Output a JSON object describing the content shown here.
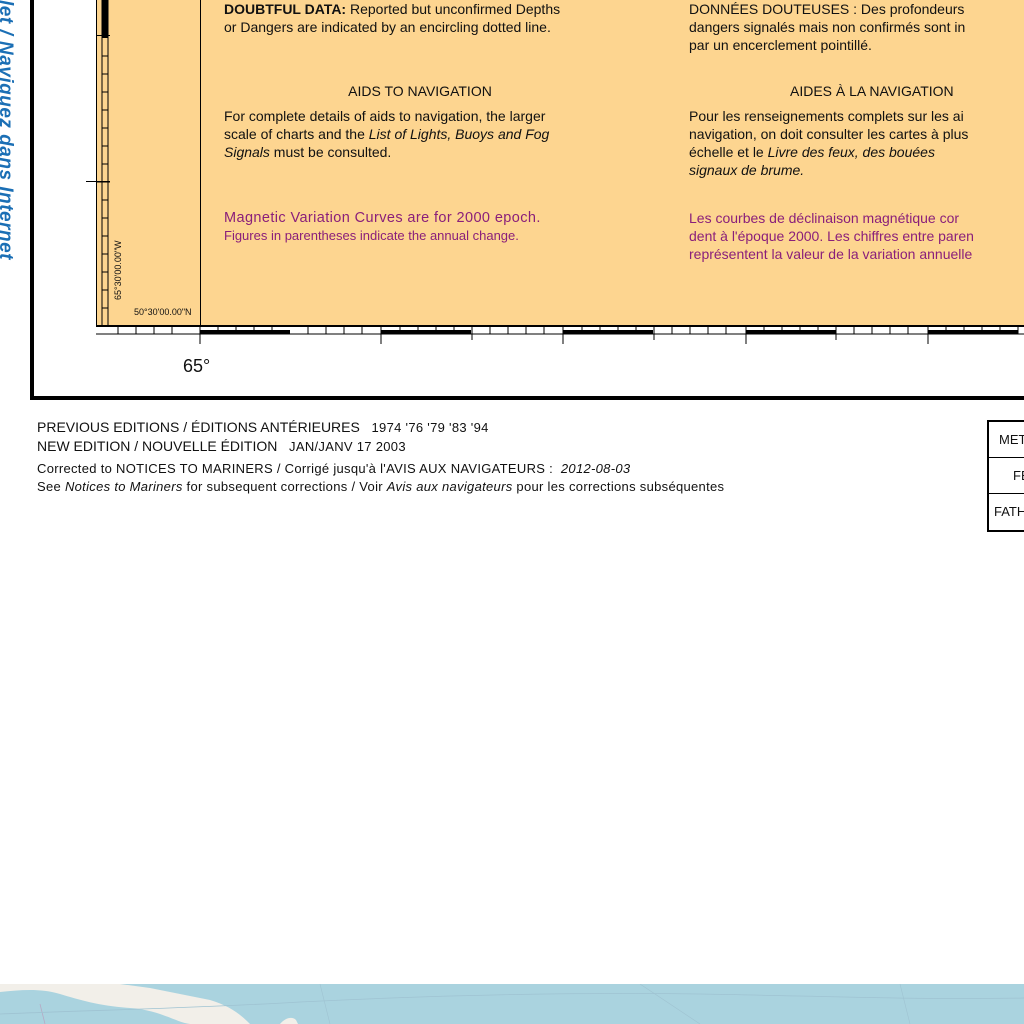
{
  "side_link": {
    "text": "let / Naviguez dans Internet",
    "color": "#1b6fb5"
  },
  "chart": {
    "panel_color": "#fdd590",
    "doubtful": {
      "en_bold": "DOUBTFUL DATA:",
      "en_rest_1": " Reported but unconfirmed Depths",
      "en_line_2": "or Dangers are indicated by an encircling dotted line.",
      "fr_line_1": "DONNÉES DOUTEUSES : Des profondeurs",
      "fr_line_2": "dangers signalés mais non confirmés sont in",
      "fr_line_3": "par un encerclement pointillé."
    },
    "aids": {
      "en_heading": "AIDS TO NAVIGATION",
      "fr_heading": "AIDES À LA NAVIGATION",
      "en_line_1": "For complete details of aids to navigation, the larger",
      "en_line_2a": "scale of charts and the ",
      "en_line_2b": "List of Lights, Buoys and Fog",
      "en_line_3a": "Signals",
      "en_line_3b": " must be consulted.",
      "fr_line_1": "Pour les renseignements complets sur les ai",
      "fr_line_2": "navigation, on doit consulter les cartes à plus",
      "fr_line_3a": "échelle et le ",
      "fr_line_3b": "Livre des feux, des bouées",
      "fr_line_4": "signaux de brume."
    },
    "magnetic": {
      "color": "#8a1f7a",
      "en_line_1": "Magnetic Variation Curves are for 2000 epoch.",
      "en_line_2": "Figures in parentheses indicate the annual change.",
      "fr_line_1": "Les courbes de déclinaison magnétique cor",
      "fr_line_2": "dent à l'époque 2000. Les chiffres entre paren",
      "fr_line_3": "représentent la valeur de la variation annuelle"
    },
    "coord_lat": "50°30'00.00\"N",
    "coord_lon": "65°30'00.00\"W",
    "degree_label": "65°"
  },
  "editions": {
    "previous_label": "PREVIOUS EDITIONS / ÉDITIONS ANTÉRIEURES",
    "previous_years": "1974 '76 '79 '83 '94",
    "new_label": "NEW EDITION / NOUVELLE ÉDITION",
    "new_date": "JAN/JANV 17 2003",
    "corrected_label": "Corrected to NOTICES TO MARINERS / Corrigé jusqu'à l'AVIS AUX NAVIGATEURS :",
    "corrected_date": "2012-08-03",
    "see_1": "See ",
    "see_notices": "Notices to Mariners",
    "see_2": " for subsequent corrections / Voir ",
    "see_avis": "Avis aux navigateurs",
    "see_3": " pour les corrections subséquentes"
  },
  "units": {
    "metres": "METRES",
    "feet": "FEET",
    "fathoms": "FATHOMS"
  },
  "basemap": {
    "water_color": "#aad3df"
  }
}
